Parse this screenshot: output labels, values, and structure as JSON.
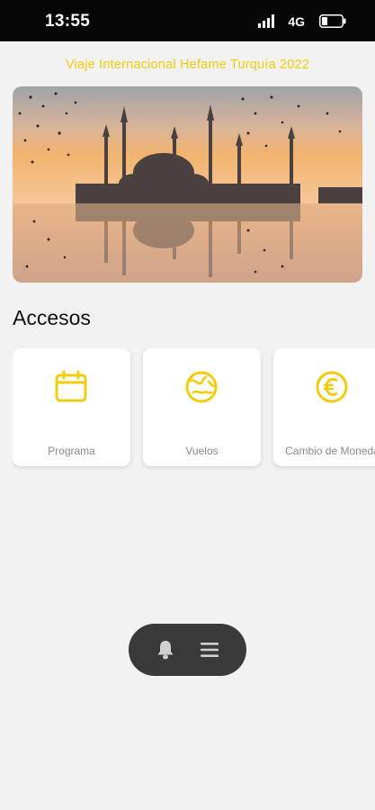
{
  "status_bar": {
    "time": "13:55",
    "network": "4G",
    "icons": [
      "signal-icon",
      "battery-icon"
    ]
  },
  "header": {
    "title": "Viaje Internacional Hefame Turquía 2022"
  },
  "hero": {
    "image": "istanbul-mosque-sunset-banner"
  },
  "accesos": {
    "title": "Accesos",
    "items": [
      {
        "label": "Programa",
        "icon": "calendar-icon"
      },
      {
        "label": "Vuelos",
        "icon": "globe-icon"
      },
      {
        "label": "Cambio de Moneda",
        "icon": "euro-icon"
      }
    ]
  },
  "bottom_nav": {
    "icons": [
      "bell-icon",
      "menu-icon"
    ]
  },
  "colors": {
    "accent": "#f2cc0c",
    "background": "#f2f2f2",
    "status_bar": "#050505",
    "nav_pill": "#3a3a3a"
  }
}
